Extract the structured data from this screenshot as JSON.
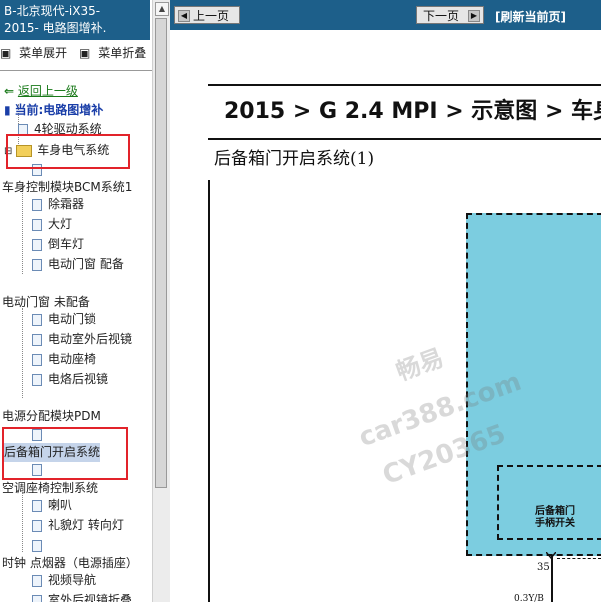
{
  "sidebar": {
    "title_line1": "B-北京现代-iX35-",
    "title_line2": "2015- 电路图增补.",
    "expand_label": "菜单展开",
    "collapse_label": "菜单折叠",
    "back_label": "返回上一级",
    "current_label": "当前:电路图增补",
    "items": [
      {
        "label": "4轮驱动系统"
      },
      {
        "label": "车身电气系统"
      },
      {
        "label": "车身控制模块BCM系统1"
      },
      {
        "label": "除霜器"
      },
      {
        "label": "大灯"
      },
      {
        "label": "倒车灯"
      },
      {
        "label": "电动门窗 配备"
      },
      {
        "label": "电动门窗 未配备"
      },
      {
        "label": "电动门锁"
      },
      {
        "label": "电动室外后视镜"
      },
      {
        "label": "电动座椅"
      },
      {
        "label": "电烙后视镜"
      },
      {
        "label": "电源分配模块PDM"
      },
      {
        "label": "后备箱门开启系统"
      },
      {
        "label": "空调座椅控制系统"
      },
      {
        "label": "喇叭"
      },
      {
        "label": "礼貌灯 转向灯"
      },
      {
        "label": "时钟 点烟器（电源插座）"
      },
      {
        "label": "视频导航"
      },
      {
        "label": "室外后视镜折叠"
      }
    ]
  },
  "toolbar": {
    "prev_label": "上一页",
    "next_label": "下一页",
    "refresh_label": "[刷新当前页]"
  },
  "main": {
    "breadcrumb": "2015 > G 2.4 MPI > 示意图 > 车身",
    "system_title": "后备箱门开启系统(1)",
    "switch_label_line1": "后备箱门",
    "switch_label_line2": "手柄开关",
    "pin_number": "35",
    "wire_code": "0.3Y/B"
  },
  "watermark": {
    "line1": "畅易",
    "line2": "car388.com",
    "line3": "CY20365"
  },
  "colors": {
    "header_bg": "#1d5f8a",
    "module_fill": "#7ccde0",
    "highlight_box": "#e2232a"
  }
}
